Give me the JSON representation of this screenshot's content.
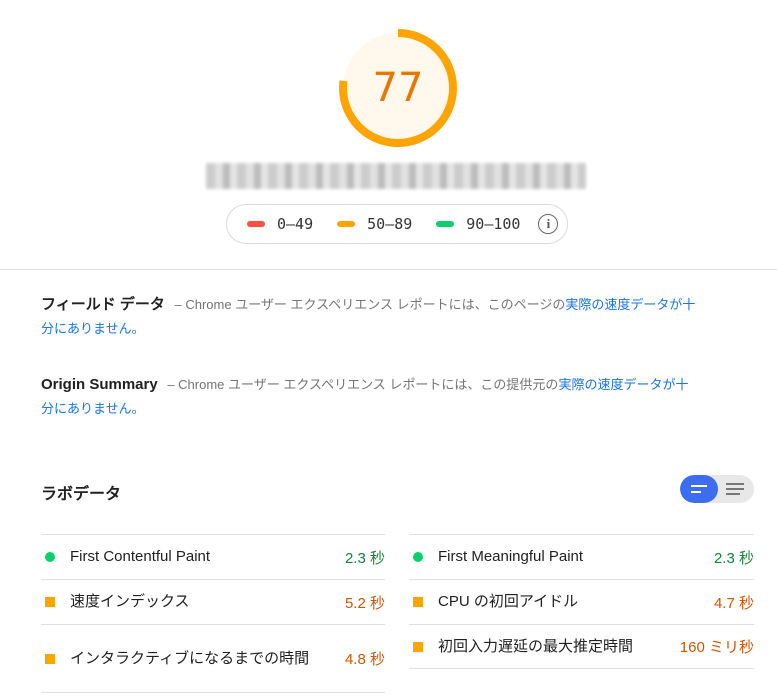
{
  "score": {
    "value": "77",
    "fraction": 0.77,
    "color": "#ffa400"
  },
  "legend": {
    "items": [
      {
        "label": "0–49",
        "color": "#ff4e42"
      },
      {
        "label": "50–89",
        "color": "#ffa400"
      },
      {
        "label": "90–100",
        "color": "#0cce6b"
      }
    ],
    "info_icon": "i"
  },
  "field_data": {
    "title": "フィールド データ",
    "text": "– Chrome ユーザー エクスペリエンス レポートには、このページの",
    "link": "実際の速度データが十分にありません。"
  },
  "origin_summary": {
    "title": "Origin Summary",
    "text": "– Chrome ユーザー エクスペリエンス レポートには、この提供元の",
    "link": "実際の速度データが十分にありません。"
  },
  "lab": {
    "title": "ラボデータ",
    "metrics": [
      {
        "name": "First Contentful Paint",
        "value": "2.3 秒",
        "status": "good"
      },
      {
        "name": "First Meaningful Paint",
        "value": "2.3 秒",
        "status": "good"
      },
      {
        "name": "速度インデックス",
        "value": "5.2 秒",
        "status": "average"
      },
      {
        "name": "CPU の初回アイドル",
        "value": "4.7 秒",
        "status": "average"
      },
      {
        "name": "インタラクティブになるまでの時間",
        "value": "4.8 秒",
        "status": "average"
      },
      {
        "name": "初回入力遅延の最大推定時間",
        "value": "160 ミリ秒",
        "status": "average"
      }
    ]
  }
}
